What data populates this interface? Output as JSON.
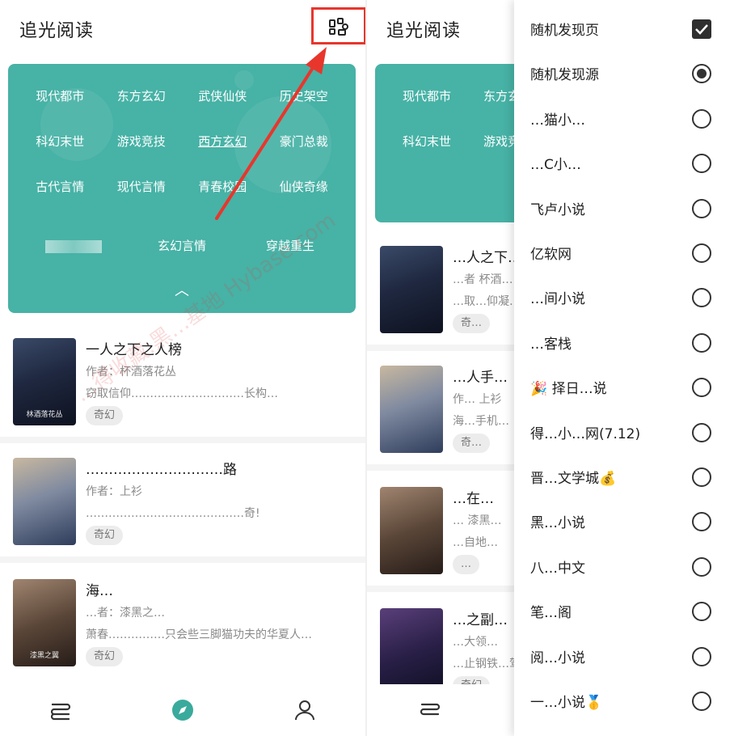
{
  "app": {
    "title": "追光阅读"
  },
  "genres": {
    "rows": [
      [
        "现代都市",
        "东方玄幻",
        "武侠仙侠",
        "历史架空"
      ],
      [
        "科幻末世",
        "游戏竞技",
        "西方玄幻",
        "豪门总裁"
      ],
      [
        "古代言情",
        "现代言情",
        "青春校园",
        "仙侠奇缘"
      ]
    ],
    "last_row": [
      "玄幻言情",
      "穿越重生"
    ],
    "collapse": "︿"
  },
  "books": [
    {
      "title": "一人之下之人榜",
      "author": "作者：杯酒落花丛",
      "desc": "窃取信仰…………………………长构…",
      "tag": "奇幻",
      "cover_text": "林酒落花丛"
    },
    {
      "title": "…………………………路",
      "author": "作者：上衫",
      "desc": "……………………………………奇!",
      "tag": "奇幻",
      "cover_text": ""
    },
    {
      "title": "海…",
      "author": "…者：漆黑之…",
      "desc": "萧春……………只会些三脚猫功夫的华夏人…",
      "tag": "奇幻",
      "cover_text": "漆黑之翼"
    }
  ],
  "right_books": [
    {
      "title": "…人之下…",
      "author": "…者 杯酒…",
      "desc": "…取…仰凝…",
      "tag": "奇…"
    },
    {
      "title": "…人手…",
      "author": "作… 上衫",
      "desc": "海…手机…",
      "tag": "奇…"
    },
    {
      "title": "…在…",
      "author": "… 漆黑…",
      "desc": "…自地…",
      "tag": "…"
    },
    {
      "title": "…之副…",
      "author": "…大领…",
      "desc": "…止钢铁…驾…",
      "tag": "奇幻"
    }
  ],
  "source_menu": {
    "items": [
      {
        "label": "随机发现页",
        "control": "checkbox",
        "checked": true
      },
      {
        "label": "随机发现源",
        "control": "radio",
        "checked": true
      },
      {
        "label": "…猫小…",
        "control": "radio",
        "checked": false
      },
      {
        "label": "…C小…",
        "control": "radio",
        "checked": false
      },
      {
        "label": "飞卢小说",
        "control": "radio",
        "checked": false
      },
      {
        "label": "亿软网",
        "control": "radio",
        "checked": false
      },
      {
        "label": "…间小说",
        "control": "radio",
        "checked": false
      },
      {
        "label": "…客栈",
        "control": "radio",
        "checked": false
      },
      {
        "label": "🎉 择日…说",
        "control": "radio",
        "checked": false
      },
      {
        "label": "得…小…网(7.12)",
        "control": "radio",
        "checked": false
      },
      {
        "label": "晋…文学城💰",
        "control": "radio",
        "checked": false
      },
      {
        "label": "黑…小说",
        "control": "radio",
        "checked": false
      },
      {
        "label": "八…中文",
        "control": "radio",
        "checked": false
      },
      {
        "label": "笔…阁",
        "control": "radio",
        "checked": false
      },
      {
        "label": "阅…小说",
        "control": "radio",
        "checked": false
      },
      {
        "label": "一…小说🥇",
        "control": "radio",
        "checked": false
      }
    ]
  },
  "watermark": "…得收藏:黑…基地 Hybase.com",
  "colors": {
    "accent": "#47b2a6",
    "highlight": "#e8362c",
    "nav_active": "#3aaa9c"
  },
  "icons": {
    "grid_button": "grid-icon",
    "nav": [
      "bookshelf-icon",
      "discover-icon",
      "profile-icon"
    ]
  }
}
